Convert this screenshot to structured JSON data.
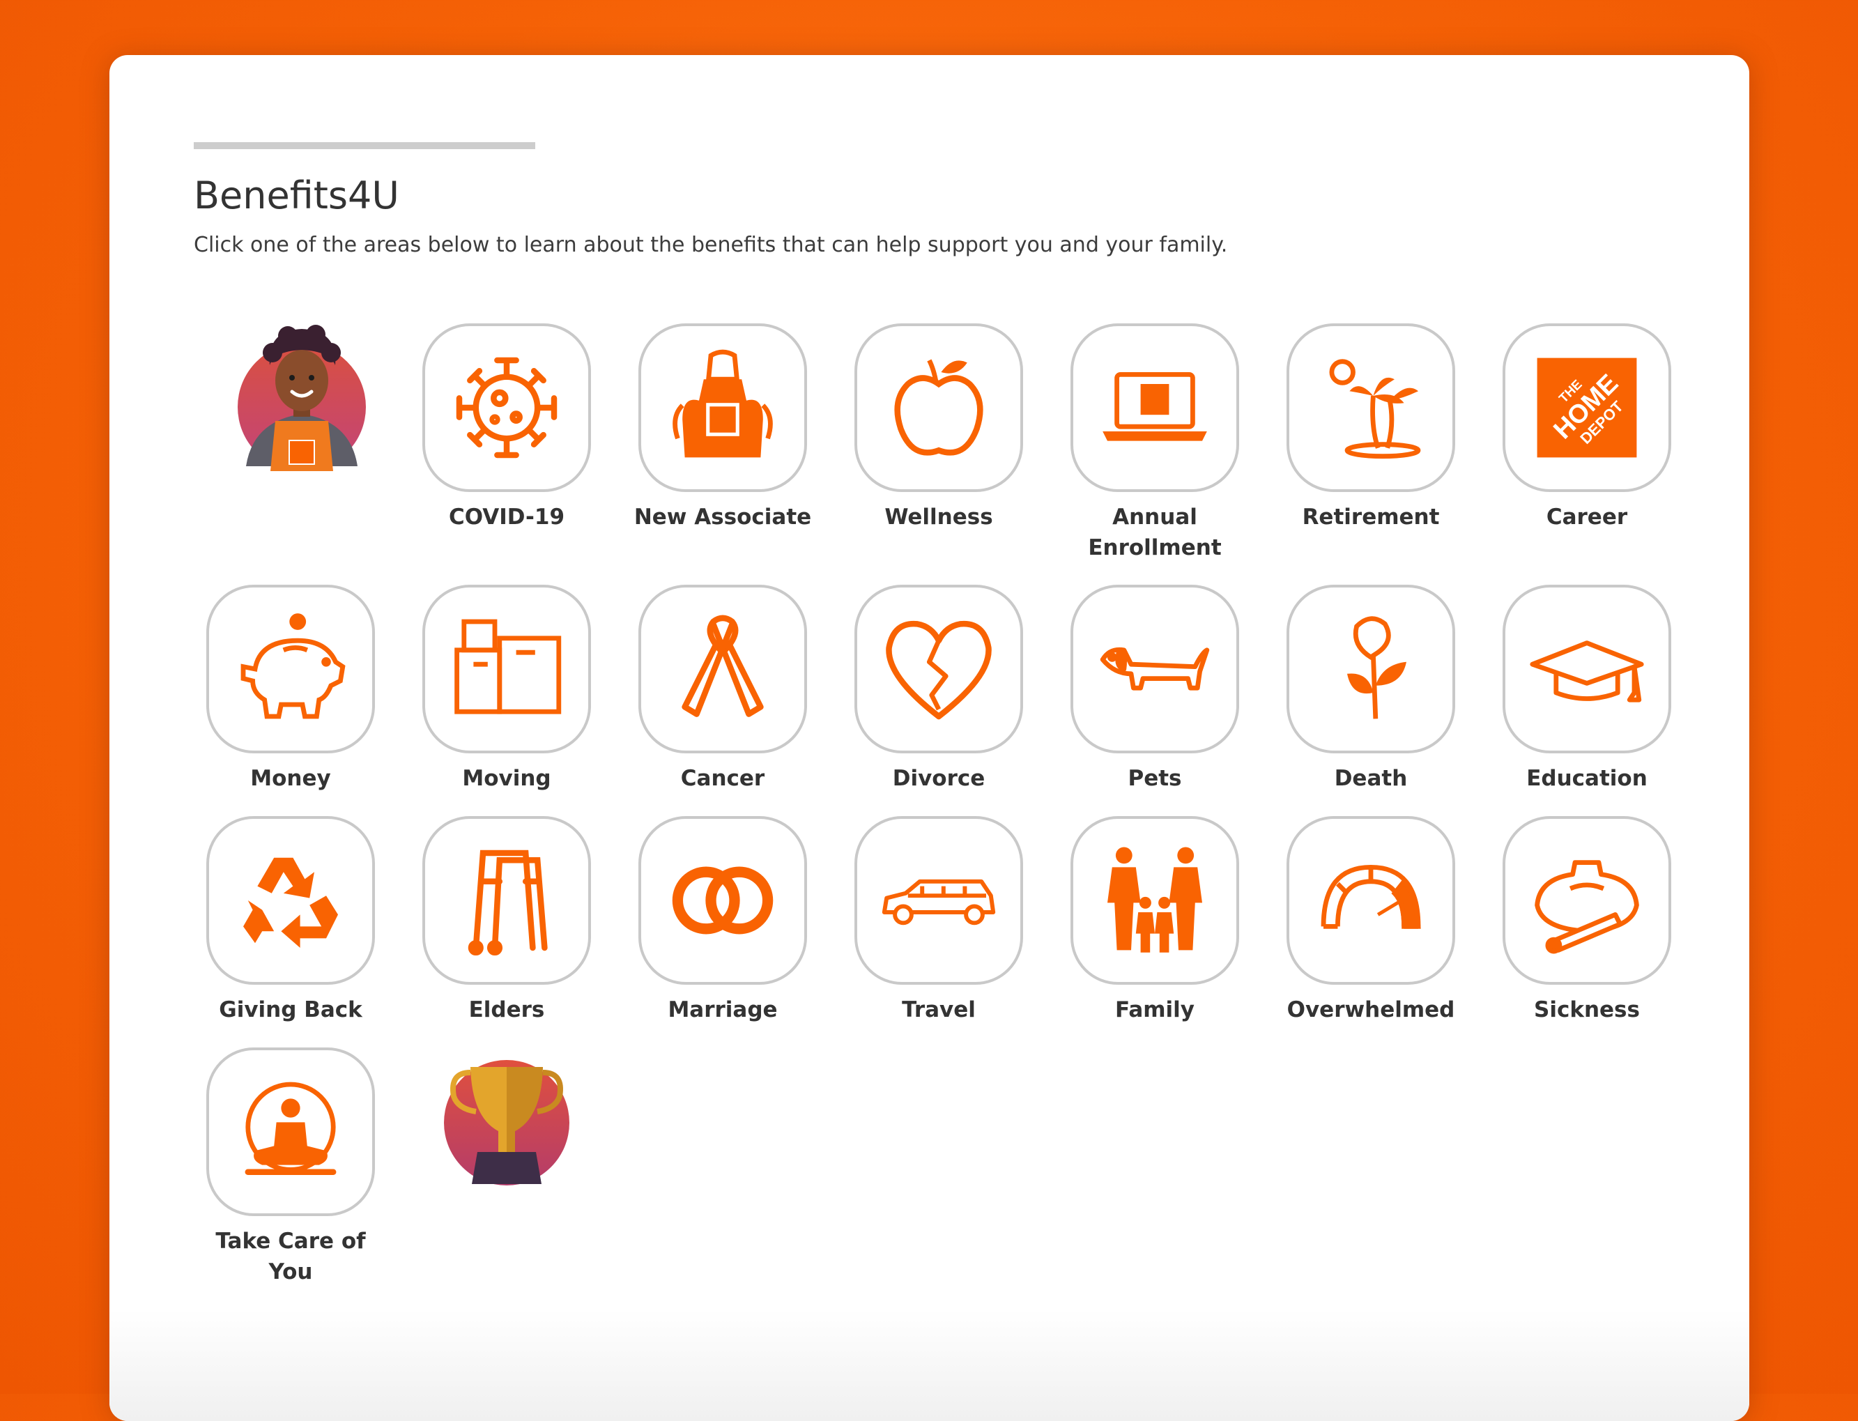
{
  "header": {
    "title": "Benefits4U",
    "subtitle": "Click one of the areas below to learn about the benefits that can help support you and your family."
  },
  "tiles": [
    {
      "label": "COVID-19",
      "icon": "virus-icon"
    },
    {
      "label": "New Associate",
      "icon": "apron-icon"
    },
    {
      "label": "Wellness",
      "icon": "apple-icon"
    },
    {
      "label": "Annual Enrollment",
      "icon": "laptop-icon"
    },
    {
      "label": "Retirement",
      "icon": "palm-tree-icon"
    },
    {
      "label": "Career",
      "icon": "home-depot-logo-icon"
    },
    {
      "label": "Money",
      "icon": "piggy-bank-icon"
    },
    {
      "label": "Moving",
      "icon": "boxes-icon"
    },
    {
      "label": "Cancer",
      "icon": "ribbon-icon"
    },
    {
      "label": "Divorce",
      "icon": "broken-heart-icon"
    },
    {
      "label": "Pets",
      "icon": "dog-icon"
    },
    {
      "label": "Death",
      "icon": "flower-icon"
    },
    {
      "label": "Education",
      "icon": "graduation-cap-icon"
    },
    {
      "label": "Giving Back",
      "icon": "recycle-icon"
    },
    {
      "label": "Elders",
      "icon": "walker-icon"
    },
    {
      "label": "Marriage",
      "icon": "rings-icon"
    },
    {
      "label": "Travel",
      "icon": "car-icon"
    },
    {
      "label": "Family",
      "icon": "family-icon"
    },
    {
      "label": "Overwhelmed",
      "icon": "gauge-icon"
    },
    {
      "label": "Sickness",
      "icon": "ice-pack-thermometer-icon"
    },
    {
      "label": "Take Care of You",
      "icon": "meditation-icon"
    }
  ],
  "brand": {
    "logo_text": "THE HOME DEPOT"
  },
  "colors": {
    "accent": "#f96302",
    "page_background": "#f56106",
    "card": "#ffffff",
    "tile_border": "#c9c9c9",
    "text": "#333333",
    "trophy_gold": "#e3a52c",
    "avatar_circle": "#d4584a"
  }
}
